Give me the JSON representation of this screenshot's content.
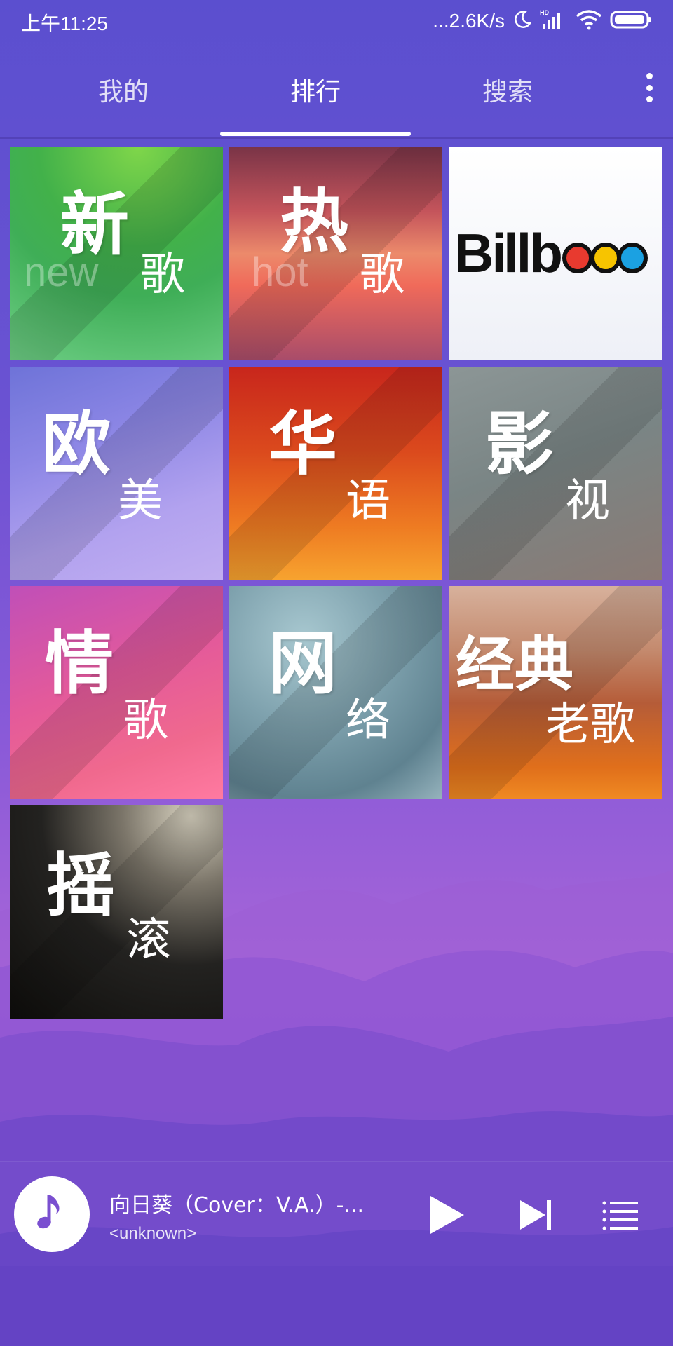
{
  "status_bar": {
    "time": "上午11:25",
    "network_speed": "...2.6K/s",
    "icons": [
      "moon-icon",
      "hd-signal-icon",
      "wifi-icon",
      "battery-icon"
    ]
  },
  "tabs": [
    {
      "label": "我的",
      "active": false
    },
    {
      "label": "排行",
      "active": true
    },
    {
      "label": "搜索",
      "active": false
    }
  ],
  "tiles": [
    {
      "big": "新",
      "small": "歌",
      "ghost": "new"
    },
    {
      "big": "热",
      "small": "歌",
      "ghost": "hot"
    },
    {
      "brand": "Billboard"
    },
    {
      "big": "欧",
      "small": "美"
    },
    {
      "big": "华",
      "small": "语"
    },
    {
      "big": "影",
      "small": "视"
    },
    {
      "big": "情",
      "small": "歌"
    },
    {
      "big": "网",
      "small": "络"
    },
    {
      "big": "经典",
      "small": "老歌"
    },
    {
      "big": "摇",
      "small": "滚"
    }
  ],
  "player": {
    "title": "向日葵（Cover：V.A.）-...",
    "artist": "<unknown>",
    "icons": [
      "music-note-icon",
      "play-icon",
      "skip-next-icon",
      "playlist-icon"
    ]
  },
  "colors": {
    "accent": "#ffffff",
    "background_top": "#5b4fcf",
    "background_mid": "#a765d8"
  }
}
